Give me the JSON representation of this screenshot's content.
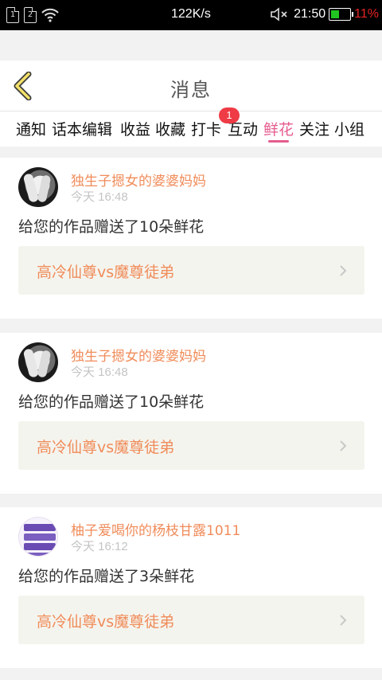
{
  "status_bar": {
    "sim1": "1",
    "sim2": "2",
    "speed": "122K/s",
    "mute_icon": "speaker-muted-icon",
    "time": "21:50",
    "battery": "11%",
    "battery_color": "#21c521",
    "battery_text_color": "#e82424"
  },
  "header": {
    "title": "消息",
    "back_icon": "chevron-left-icon"
  },
  "tabs": {
    "items": [
      "通知",
      "话本编辑",
      "收益",
      "收藏",
      "打卡",
      "互动",
      "鲜花",
      "关注",
      "小组"
    ],
    "active": "鲜花",
    "badge": "1",
    "active_color": "#e55c8e"
  },
  "cards": [
    {
      "username": "独生子摁女的婆婆妈妈",
      "time": "今天 16:48",
      "message": "给您的作品赠送了10朵鲜花",
      "work_title": "高冷仙尊vs魔尊徒弟"
    },
    {
      "username": "独生子摁女的婆婆妈妈",
      "time": "今天 16:48",
      "message": "给您的作品赠送了10朵鲜花",
      "work_title": "高冷仙尊vs魔尊徒弟"
    },
    {
      "username": "柚子爱喝你的杨枝甘露1011",
      "time": "今天 16:12",
      "message": "给您的作品赠送了3朵鲜花",
      "work_title": "高冷仙尊vs魔尊徒弟"
    }
  ],
  "accent_color": "#f08c5a"
}
